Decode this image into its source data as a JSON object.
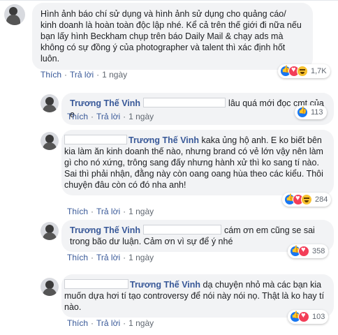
{
  "comments": [
    {
      "author": "",
      "text": "Hình ảnh báo chí sử dụng và hình ảnh sử dụng cho quảng cáo/ kinh doanh là hoàn toàn độc lập nhé. Kể cả trên thế giới đi nữa nếu bạn lấy hình Beckham chụp trên báo Daily Mail & chạy ads mà không có sự đồng ý của photographer và talent thì xác định hốt luôn.",
      "like": "Thích",
      "reply": "Trả lời",
      "time": "1 ngày",
      "reactions": [
        "like-icon",
        "love-icon",
        "haha-icon"
      ],
      "count": "1,7K"
    },
    {
      "author": "Trương Thế Vinh",
      "text": "lâu quá mới đọc cmt của e",
      "like": "Thích",
      "reply": "Trả lời",
      "time": "1 ngày",
      "reactions": [
        "like-icon"
      ],
      "count": "113"
    },
    {
      "author": "Trương Thế Vinh",
      "text": "kaka ủng hộ anh. E ko biết bên kia làm ăn kinh doanh thế nào, nhưng brand có vẻ lớn vậy nên làm gì cho nó xứng, trông sang đấy nhưng hành xử thì ko sang tí nào. Sai thì phải nhận, đằng này còn oang oang hùa theo các kiểu. Thôi chuyện đâu còn có đó nha anh!",
      "like": "Thích",
      "reply": "Trả lời",
      "time": "1 ngày",
      "reactions": [
        "like-icon",
        "love-icon",
        "haha-icon"
      ],
      "count": "284"
    },
    {
      "author": "Trương Thế Vinh",
      "text": "cám ơn em cũng se sai trong bão dư luận. Cảm ơn vì sự để ý nhé",
      "like": "Thích",
      "reply": "Trả lời",
      "time": "1 ngày",
      "reactions": [
        "like-icon",
        "love-icon"
      ],
      "count": "358"
    },
    {
      "author": "Trương Thế Vinh",
      "text": "dạ chuyện nhỏ mà các bạn kia muốn dựa hơi tí tạo controversy để nói này nói nọ. Thật là ko hay tí nào.",
      "like": "Thích",
      "reply": "Trả lời",
      "time": "1 ngày",
      "reactions": [
        "like-icon",
        "love-icon"
      ],
      "count": "103"
    }
  ]
}
